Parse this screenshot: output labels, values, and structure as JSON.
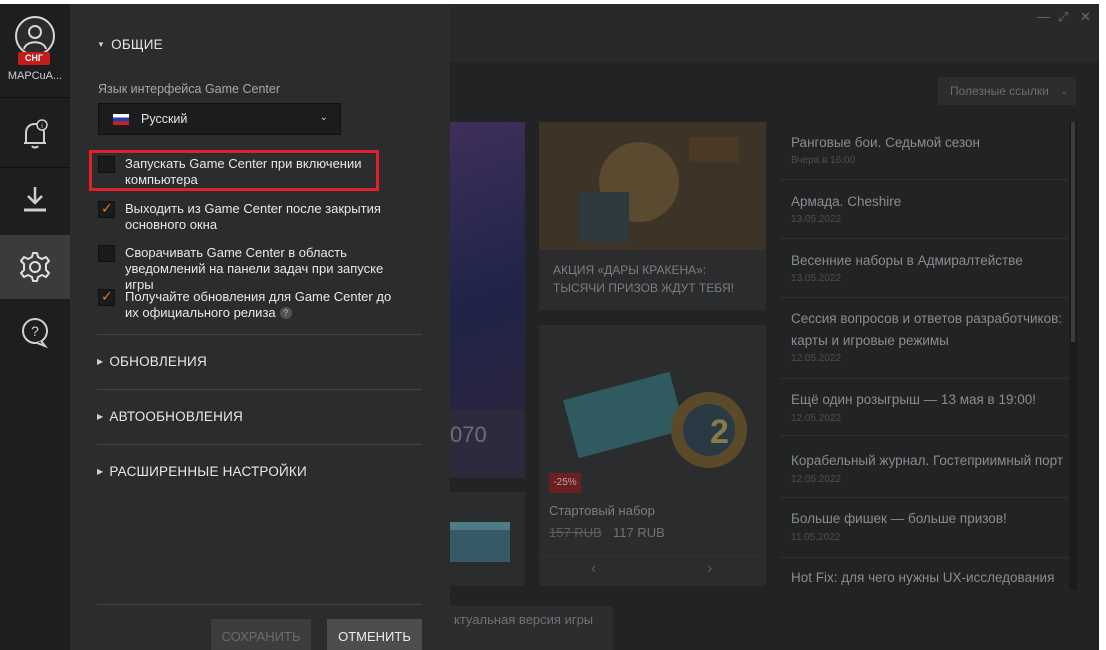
{
  "sidebar": {
    "region_badge": "СНГ",
    "username": "МАРСuA..."
  },
  "settings": {
    "general_heading": "ОБЩИЕ",
    "language_label": "Язык интерфейса Game Center",
    "language_value": "Русский",
    "options": [
      {
        "label": "Запускать Game Center при включении компьютера",
        "checked": false
      },
      {
        "label": "Выходить из Game Center после закрытия основного окна",
        "checked": true
      },
      {
        "label": "Сворачивать Game Center в область уведомлений на панели задач при запуске игры",
        "checked": false
      },
      {
        "label": "Получайте обновления для Game Center до их официального релиза",
        "checked": true
      }
    ],
    "sections": [
      "ОБНОВЛЕНИЯ",
      "АВТООБНОВЛЕНИЯ",
      "РАСШИРЕННЫЕ НАСТРОЙКИ"
    ],
    "save_label": "СОХРАНИТЬ",
    "cancel_label": "ОТМЕНИТЬ",
    "help_glyph": "?"
  },
  "background": {
    "useful_links": "Полезные ссылки",
    "promo_card": {
      "line1": "АКЦИЯ «ДАРЫ КРАКЕНА»:",
      "line2": "ТЫСЯЧИ ПРИЗОВ ЖДУТ ТЕБЯ!"
    },
    "starter_pack": {
      "discount": "-25%",
      "title": "Стартовый набор",
      "old_price": "157 RUB",
      "new_price": "117 RUB",
      "badge_number": "2"
    },
    "partial_number": "070",
    "bottom_text": "ктуальная версия игры",
    "news": [
      {
        "title": "Ранговые бои. Седьмой сезон",
        "date": "Вчера в 16:00"
      },
      {
        "title": "Армада. Cheshire",
        "date": "13.05.2022"
      },
      {
        "title": "Весенние наборы в Адмиралтействе",
        "date": "13.05.2022"
      },
      {
        "title": "Сессия вопросов и ответов разработчиков: карты и игровые режимы",
        "date": "12.05.2022"
      },
      {
        "title": "Ещё один розыгрыш — 13 мая в 19:00!",
        "date": "12.05.2022"
      },
      {
        "title": "Корабельный журнал. Гостеприимный порт",
        "date": "12.05.2022"
      },
      {
        "title": "Больше фишек — больше призов!",
        "date": "11.05.2022"
      },
      {
        "title": "Hot Fix: для чего нужны UX-исследования",
        "date": ""
      }
    ]
  },
  "colors": {
    "highlight": "#e3202a",
    "checkbox_check": "#e07b1e",
    "region_badge": "#c41b1b"
  }
}
